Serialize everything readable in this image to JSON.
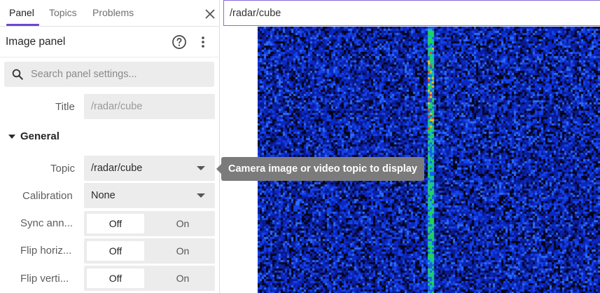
{
  "tabs": [
    {
      "label": "Panel",
      "active": true
    },
    {
      "label": "Topics",
      "active": false
    },
    {
      "label": "Problems",
      "active": false
    }
  ],
  "panel": {
    "name": "Image panel",
    "search_placeholder": "Search panel settings..."
  },
  "fields": {
    "title_label": "Title",
    "title_placeholder": "/radar/cube",
    "section_general": "General",
    "topic_label": "Topic",
    "topic_value": "/radar/cube",
    "calibration_label": "Calibration",
    "calibration_value": "None",
    "sync_label": "Sync ann...",
    "flip_h_label": "Flip horiz...",
    "flip_v_label": "Flip verti...",
    "off_label": "Off",
    "on_label": "On"
  },
  "tooltip": "Camera image or video topic to display",
  "main": {
    "title": "/radar/cube"
  },
  "colors": {
    "accent": "#6c45d1",
    "tooltip_bg": "#7b7b7b",
    "field_bg": "#ececec"
  },
  "icons": [
    "close-icon",
    "help-icon",
    "more-vertical-icon",
    "search-icon",
    "chevron-down-icon"
  ]
}
